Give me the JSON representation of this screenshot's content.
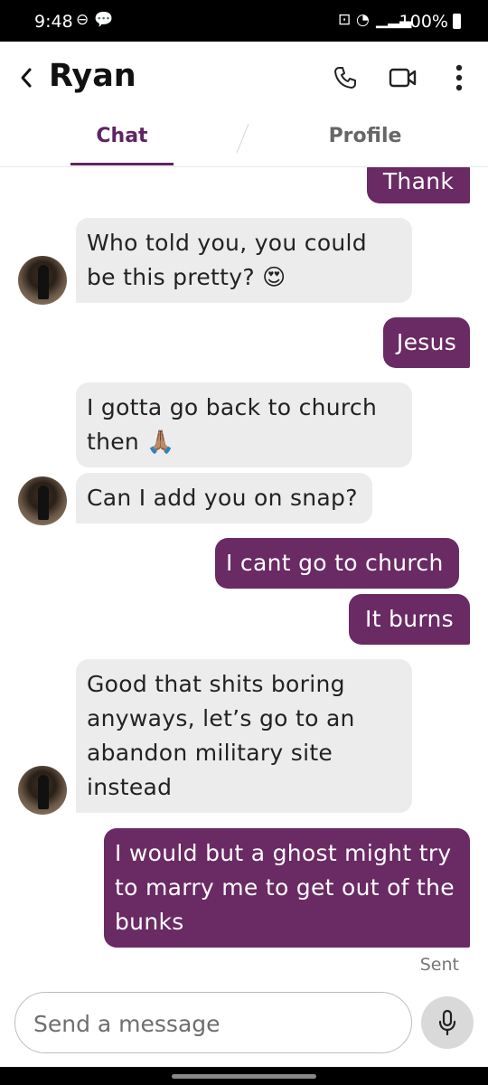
{
  "status_bar": {
    "time": "9:48",
    "battery": "100%"
  },
  "header": {
    "title": "Ryan",
    "tabs": [
      {
        "label": "Chat"
      },
      {
        "label": "Profile"
      }
    ],
    "icons": [
      "back-icon",
      "phone-icon",
      "video-icon",
      "more-icon"
    ]
  },
  "messages": [
    {
      "from": "me",
      "text": "Thanks"
    },
    {
      "from": "them",
      "text": "Who told you, you could be this pretty? 😍"
    },
    {
      "from": "me",
      "text": "Jesus"
    },
    {
      "from": "them",
      "text": "I gotta go back to church then 🙏🏽"
    },
    {
      "from": "them",
      "text": "Can I add you on snap?"
    },
    {
      "from": "me",
      "text": "I cant go to church"
    },
    {
      "from": "me",
      "text": "It burns"
    },
    {
      "from": "them",
      "text": "Good that shits boring anyways, let’s go to an abandon military site instead"
    },
    {
      "from": "me",
      "text": "I would but a ghost might try to marry me to get out of the bunks"
    }
  ],
  "status_label": "Sent",
  "composer": {
    "placeholder": "Send a message"
  },
  "colors": {
    "accent": "#6a2a64",
    "incoming_bubble": "#ececec",
    "tab_active": "#5f2461"
  }
}
